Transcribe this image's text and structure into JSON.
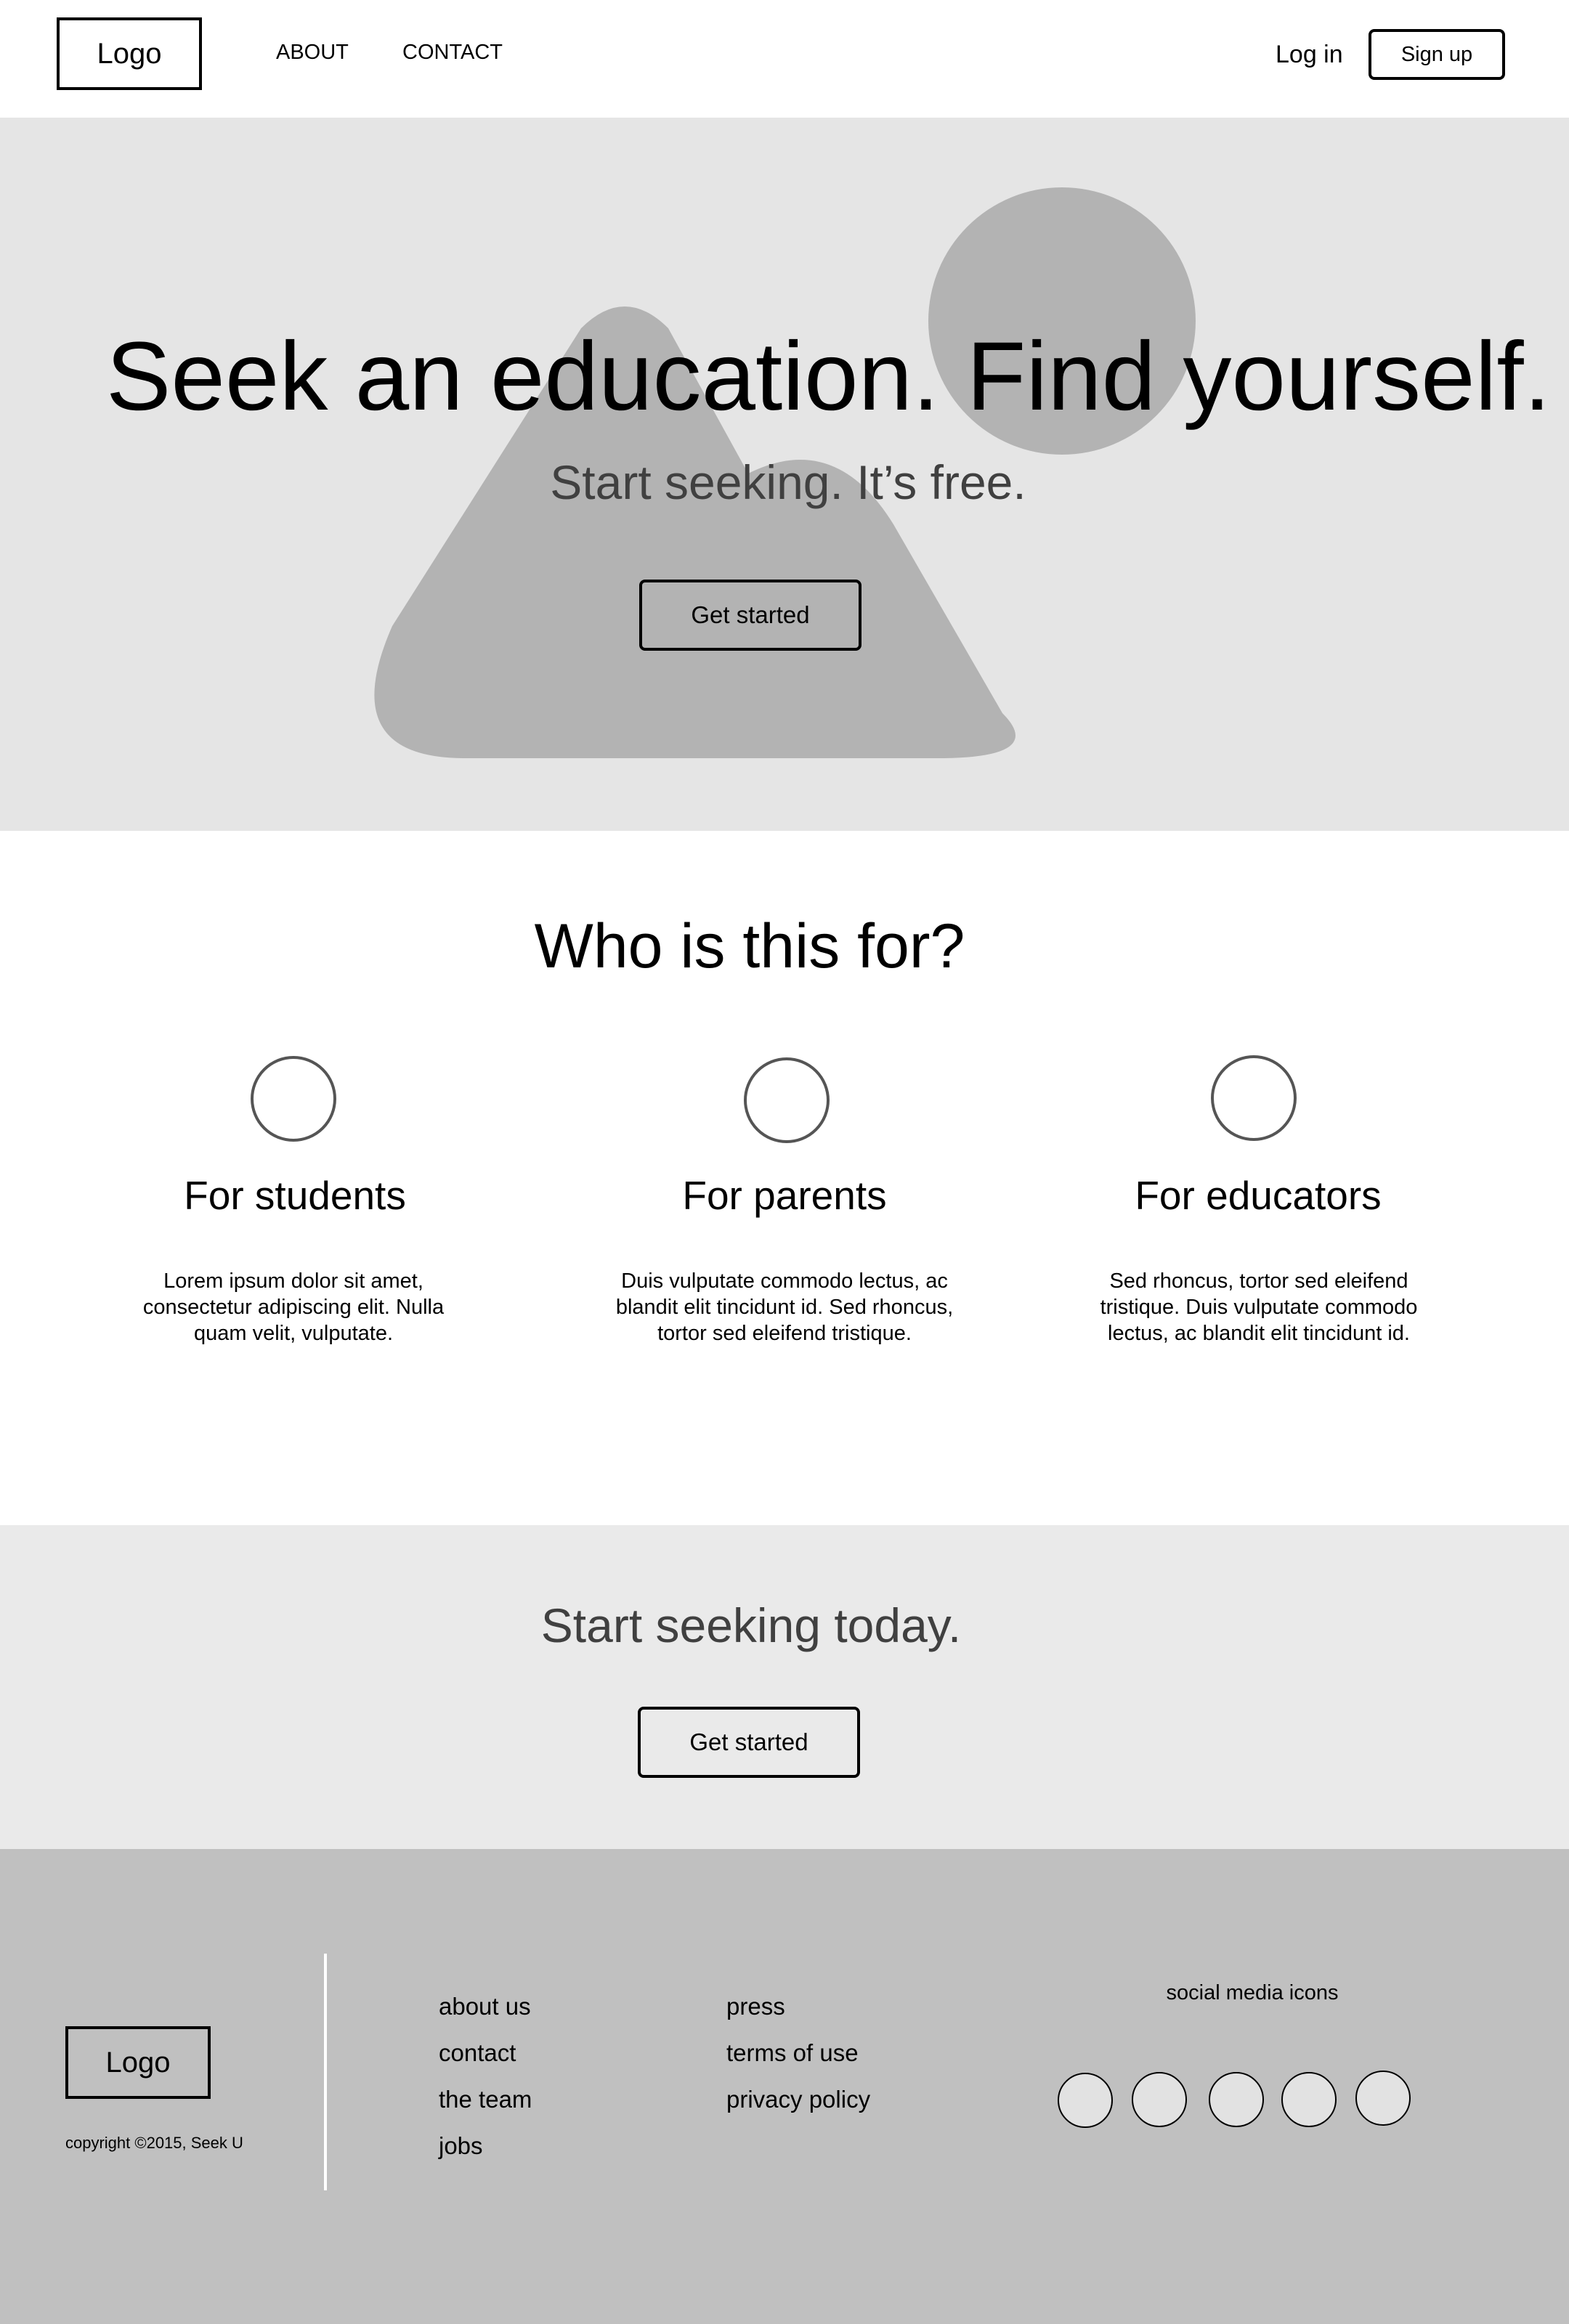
{
  "header": {
    "logo": "Logo",
    "nav": [
      {
        "label": "ABOUT"
      },
      {
        "label": "CONTACT"
      }
    ],
    "login_label": "Log in",
    "signup_label": "Sign up"
  },
  "hero": {
    "title": "Seek an education. Find yourself.",
    "subtitle": "Start seeking. It’s free.",
    "cta_label": "Get started",
    "image_icon": "image-placeholder-icon"
  },
  "audience": {
    "heading": "Who is this for?",
    "items": [
      {
        "title": "For students",
        "body": "Lorem ipsum dolor sit amet, consectetur adipiscing elit. Nulla quam velit, vulputate."
      },
      {
        "title": "For parents",
        "body": "Duis vulputate commodo lectus, ac blandit elit tincidunt id. Sed rhoncus, tortor sed eleifend tristique."
      },
      {
        "title": "For educators",
        "body": "Sed rhoncus, tortor sed eleifend tristique. Duis vulputate commodo lectus, ac blandit elit tincidunt id."
      }
    ]
  },
  "cta": {
    "heading": "Start seeking today.",
    "button_label": "Get started"
  },
  "footer": {
    "logo": "Logo",
    "copyright": "copyright ©2015, Seek U",
    "links_col1": [
      "about us",
      "contact",
      "the team",
      "jobs"
    ],
    "links_col2": [
      "press",
      "terms of use",
      "privacy policy"
    ],
    "social_heading": "social media icons",
    "social_count": 5
  },
  "colors": {
    "hero_bg": "#e5e5e5",
    "cta_bg": "#eaeaea",
    "footer_bg": "#c0c0c0",
    "placeholder_shape": "#b3b3b3"
  }
}
